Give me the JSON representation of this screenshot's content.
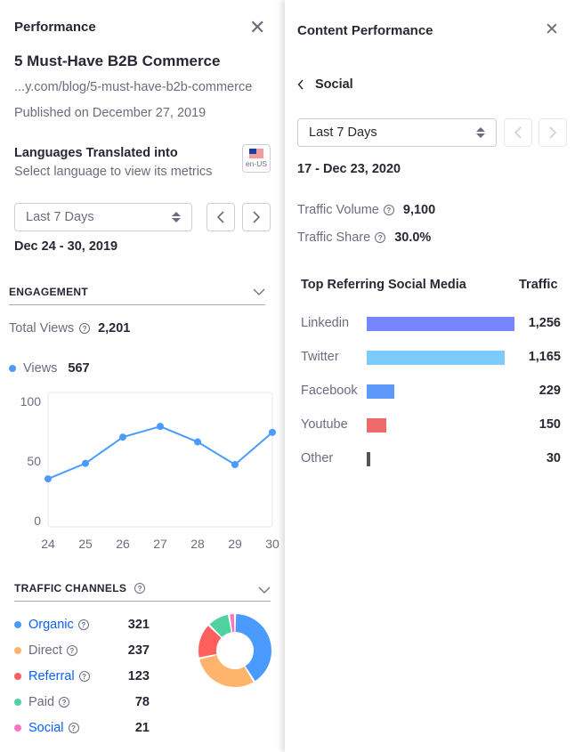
{
  "left_panel": {
    "title": "Performance",
    "close_icon": "close-icon",
    "article_title": "5 Must-Have B2B Commerce",
    "url": "...y.com/blog/5-must-have-b2b-commerce",
    "published": "Published on December 27, 2019",
    "languages": {
      "heading": "Languages Translated into",
      "subtext": "Select language to view its metrics",
      "flag_label": "en-US"
    },
    "date_select": {
      "value": "Last 7 Days"
    },
    "date_range": "Dec 24 -  30, 2019",
    "engagement": {
      "heading": "ENGAGEMENT",
      "total_views_label": "Total Views",
      "total_views_value": "2,201",
      "legend_label": "Views",
      "legend_value": "567",
      "series_color": "#4b9bff"
    },
    "traffic_channels": {
      "heading": "TRAFFIC CHANNELS",
      "channels": [
        {
          "label": "Organic",
          "value": "321",
          "count": 321,
          "color": "#4b9bff",
          "link": true
        },
        {
          "label": "Direct",
          "value": "237",
          "count": 237,
          "color": "#ffb46e",
          "link": false
        },
        {
          "label": "Referral",
          "value": "123",
          "count": 123,
          "color": "#ff5f5f",
          "link": true
        },
        {
          "label": "Paid",
          "value": "78",
          "count": 78,
          "color": "#50d2a0",
          "link": false
        },
        {
          "label": "Social",
          "value": "21",
          "count": 21,
          "color": "#ff73c3",
          "link": true
        }
      ]
    }
  },
  "right_panel": {
    "title": "Content Performance",
    "close_icon": "close-icon",
    "back_label": "Social",
    "date_select": {
      "value": "Last 7 Days"
    },
    "date_range": "17 - Dec 23, 2020",
    "traffic_volume_label": "Traffic Volume",
    "traffic_volume_value": "9,100",
    "traffic_share_label": "Traffic Share",
    "traffic_share_value": "30.0%",
    "table_header": {
      "name": "Top Referring Social Media",
      "traffic": "Traffic"
    },
    "referrers": [
      {
        "label": "Linkedin",
        "value": "1,256",
        "count": 1256,
        "color": "#7785ff"
      },
      {
        "label": "Twitter",
        "value": "1,165",
        "count": 1165,
        "color": "#7ccbfc"
      },
      {
        "label": "Facebook",
        "value": "229",
        "count": 229,
        "color": "#5c99f9"
      },
      {
        "label": "Youtube",
        "value": "150",
        "count": 150,
        "color": "#ef6b6b"
      },
      {
        "label": "Other",
        "value": "30",
        "count": 30,
        "color": "#555555"
      }
    ]
  },
  "chart_data": [
    {
      "type": "line",
      "title": "Views",
      "x": [
        "24",
        "25",
        "26",
        "27",
        "28",
        "29",
        "30"
      ],
      "series": [
        {
          "name": "Views",
          "values": [
            35,
            48,
            70,
            79,
            66,
            47,
            74
          ]
        }
      ],
      "yticks": [
        "0",
        "50",
        "100"
      ],
      "ylim": [
        0,
        100
      ],
      "xlabel": "",
      "ylabel": "",
      "grid": false
    },
    {
      "type": "pie",
      "title": "Traffic Channels",
      "categories": [
        "Organic",
        "Direct",
        "Referral",
        "Paid",
        "Social"
      ],
      "values": [
        321,
        237,
        123,
        78,
        21
      ]
    },
    {
      "type": "bar",
      "title": "Top Referring Social Media",
      "categories": [
        "Linkedin",
        "Twitter",
        "Facebook",
        "Youtube",
        "Other"
      ],
      "values": [
        1256,
        1165,
        229,
        150,
        30
      ]
    }
  ]
}
